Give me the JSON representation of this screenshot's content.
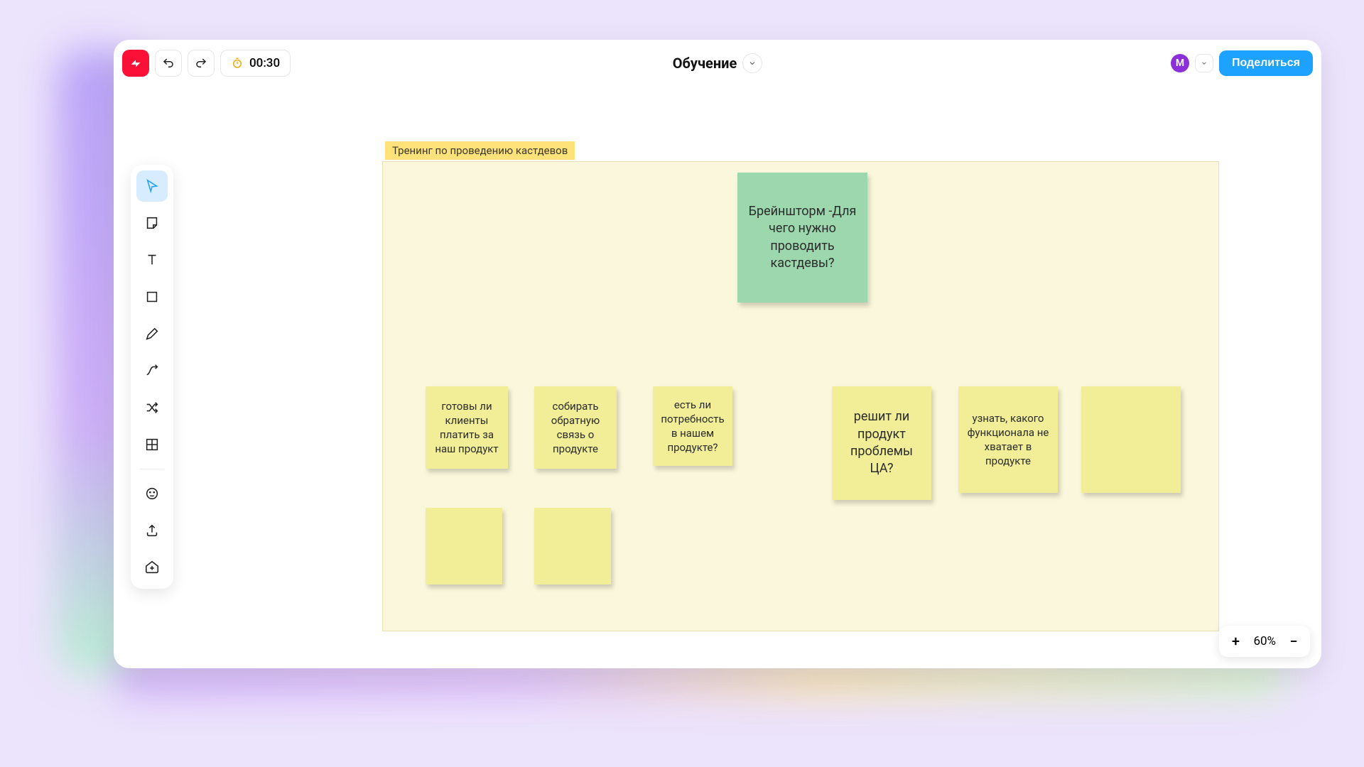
{
  "topbar": {
    "timer": "00:30",
    "title": "Обучение",
    "avatar_initial": "М",
    "share_label": "Поделиться"
  },
  "board": {
    "tag": "Тренинг по проведению кастдевов"
  },
  "stickies": {
    "main": "Брейншторм -Для чего нужно проводить кастдевы?",
    "s1": "готовы ли клиенты платить за наш продукт",
    "s2": "собирать обратную связь о продукте",
    "s3": "есть ли потребность в нашем продукте?",
    "s4": "решит ли продукт проблемы ЦА?",
    "s5": "узнать, какого функционала не хватает в продукте",
    "s6": "",
    "s7": "",
    "s8": ""
  },
  "zoom": {
    "level": "60%"
  }
}
